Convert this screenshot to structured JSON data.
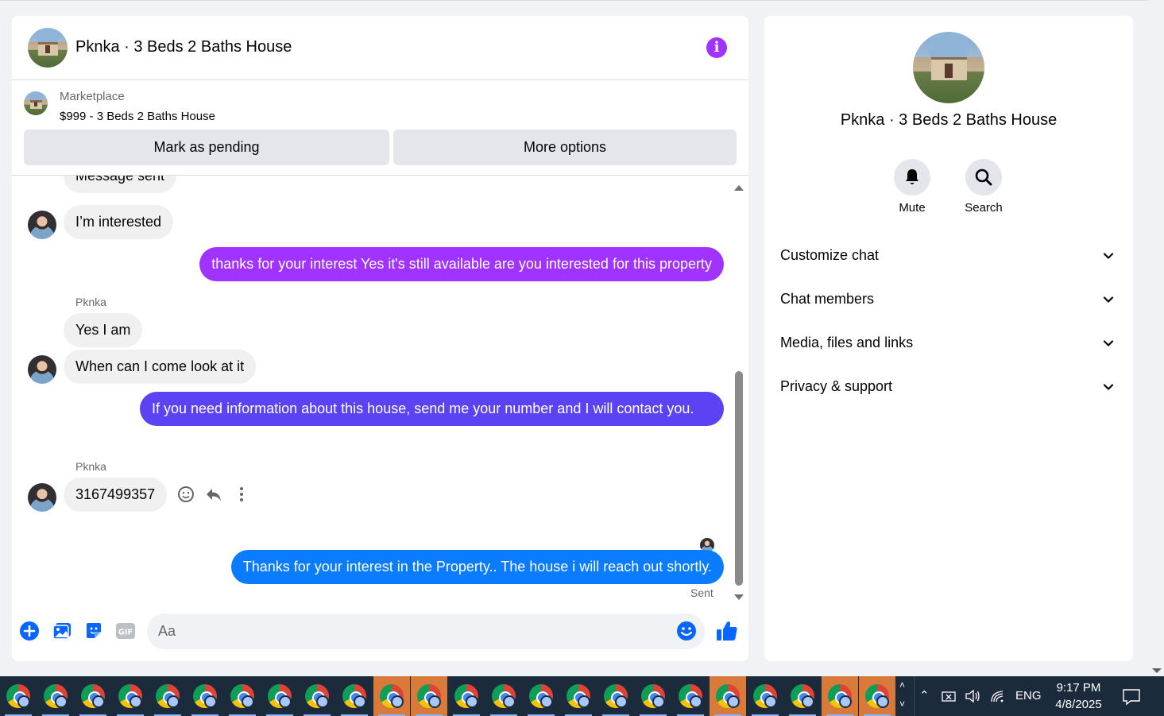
{
  "header": {
    "title": "Pknka · 3 Beds 2 Baths House"
  },
  "listing": {
    "label": "Marketplace",
    "price_title": "$999 - 3 Beds 2 Baths House",
    "mark_pending": "Mark as pending",
    "more_options": "More options"
  },
  "messages": [
    {
      "from": "them",
      "text": "Message sent"
    },
    {
      "from": "them",
      "text": "I’m interested"
    },
    {
      "from": "me",
      "text": "thanks for your interest Yes it's still available are you interested for this property"
    },
    {
      "from": "them",
      "sender": "Pknka",
      "text": "Yes I am"
    },
    {
      "from": "them",
      "text": "When can I come look at it"
    },
    {
      "from": "me",
      "text": "If you need information about this house, send me your number and I will contact you."
    },
    {
      "from": "them",
      "sender": "Pknka",
      "text": "3167499357"
    },
    {
      "from": "me",
      "text": "Thanks for your interest in the Property.. The house i will reach  out shortly."
    }
  ],
  "sent_label": "Sent",
  "composer": {
    "placeholder": "Aa"
  },
  "info": {
    "title": "Pknka · 3 Beds 2 Baths House",
    "mute_label": "Mute",
    "search_label": "Search",
    "sections": [
      "Customize chat",
      "Chat members",
      "Media, files and links",
      "Privacy & support"
    ]
  },
  "taskbar": {
    "language": "ENG",
    "time": "9:17 PM",
    "date": "4/8/2025"
  },
  "colors": {
    "accent_purple": "#a033ff",
    "accent_violet": "#5b42f3",
    "accent_blue": "#0a7cff",
    "icon_blue": "#0866ff"
  }
}
